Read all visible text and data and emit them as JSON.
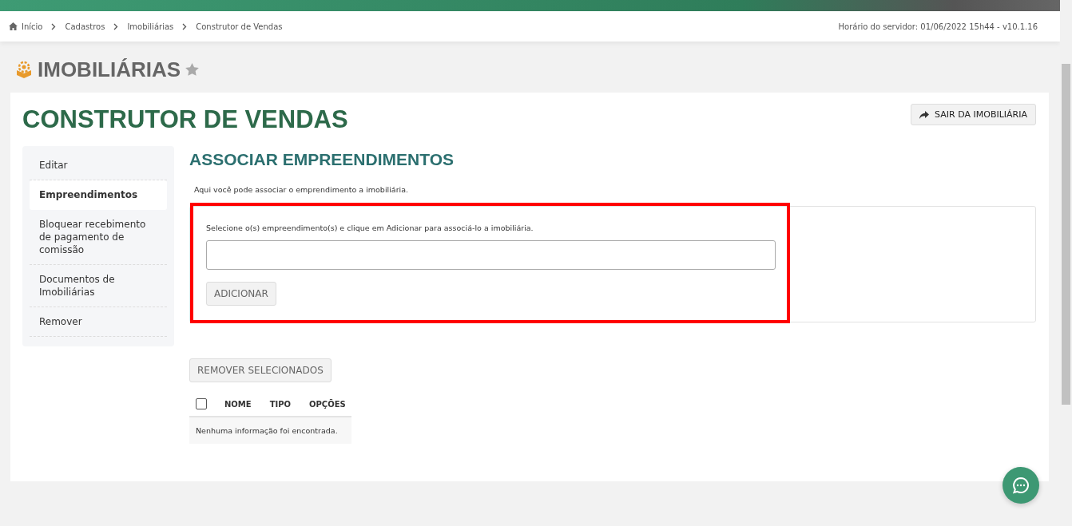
{
  "breadcrumb": [
    {
      "label": "Início",
      "kind": "home"
    },
    {
      "label": "Cadastros",
      "kind": "link"
    },
    {
      "label": "Imobiliárias",
      "kind": "link"
    },
    {
      "label": "Construtor de Vendas",
      "kind": "current"
    }
  ],
  "server_time": "Horário do servidor: 01/06/2022 15h44 - v10.1.16",
  "page_title": "IMOBILIÁRIAS",
  "card": {
    "title": "CONSTRUTOR DE VENDAS",
    "exit_button": "SAIR DA IMOBILIÁRIA"
  },
  "sidebar": {
    "items": [
      {
        "label": "Editar",
        "selected": false
      },
      {
        "label": "Empreendimentos",
        "selected": true
      },
      {
        "label": "Bloquear recebimento de pagamento de comissão",
        "selected": false
      },
      {
        "label": "Documentos de Imobiliárias",
        "selected": false
      },
      {
        "label": "Remover",
        "selected": false
      }
    ]
  },
  "section": {
    "title": "ASSOCIAR EMPREENDIMENTOS",
    "description": "Aqui você pode associar o emprendimento a imobiliária.",
    "instruction": "Selecione o(s) empreendimento(s) e clique em Adicionar para associá-lo a imobiliária.",
    "add_button": "ADICIONAR",
    "remove_button": "REMOVER SELECIONADOS"
  },
  "table": {
    "select_all": {
      "checked": false
    },
    "columns": [
      "NOME",
      "TIPO",
      "OPÇÕES"
    ],
    "empty_message": "Nenhuma informação foi encontrada."
  }
}
